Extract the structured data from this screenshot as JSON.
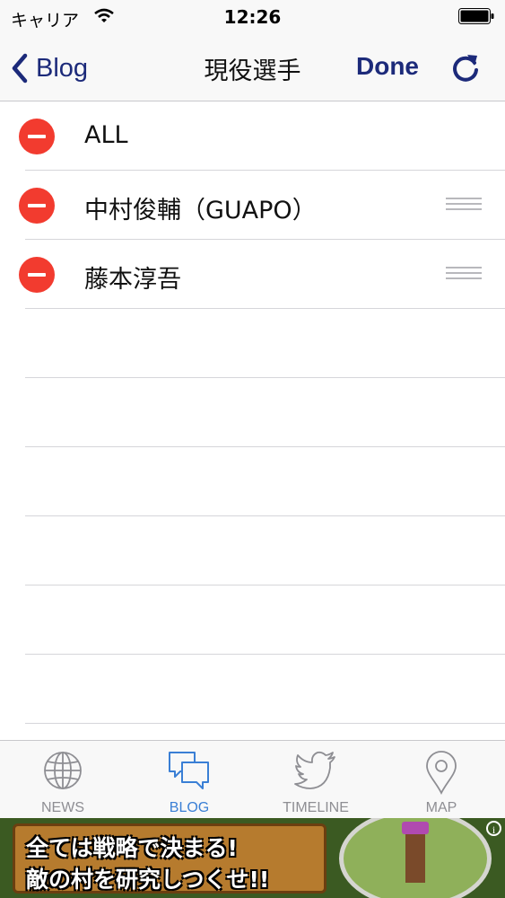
{
  "status_bar": {
    "carrier": "キャリア",
    "time": "12:26"
  },
  "navbar": {
    "back_label": "Blog",
    "title": "現役選手",
    "done_label": "Done"
  },
  "list": {
    "items": [
      {
        "label": "ALL",
        "reorderable": false
      },
      {
        "label": "中村俊輔（GUAPO）",
        "reorderable": true
      },
      {
        "label": "藤本淳吾",
        "reorderable": true
      }
    ]
  },
  "tabbar": {
    "tabs": [
      {
        "label": "NEWS",
        "icon": "globe-icon",
        "active": false
      },
      {
        "label": "BLOG",
        "icon": "chat-bubbles-icon",
        "active": true
      },
      {
        "label": "TIMELINE",
        "icon": "twitter-bird-icon",
        "active": false
      },
      {
        "label": "MAP",
        "icon": "map-pin-icon",
        "active": false
      }
    ]
  },
  "ad": {
    "line1": "全ては戦略で決まる!",
    "line2": "敵の村を研究しつくせ!!",
    "info": "i"
  },
  "colors": {
    "nav_tint": "#1c2a7a",
    "delete_red": "#f23b2f",
    "tab_active": "#3a7fd5",
    "tab_inactive": "#8e8e93"
  }
}
